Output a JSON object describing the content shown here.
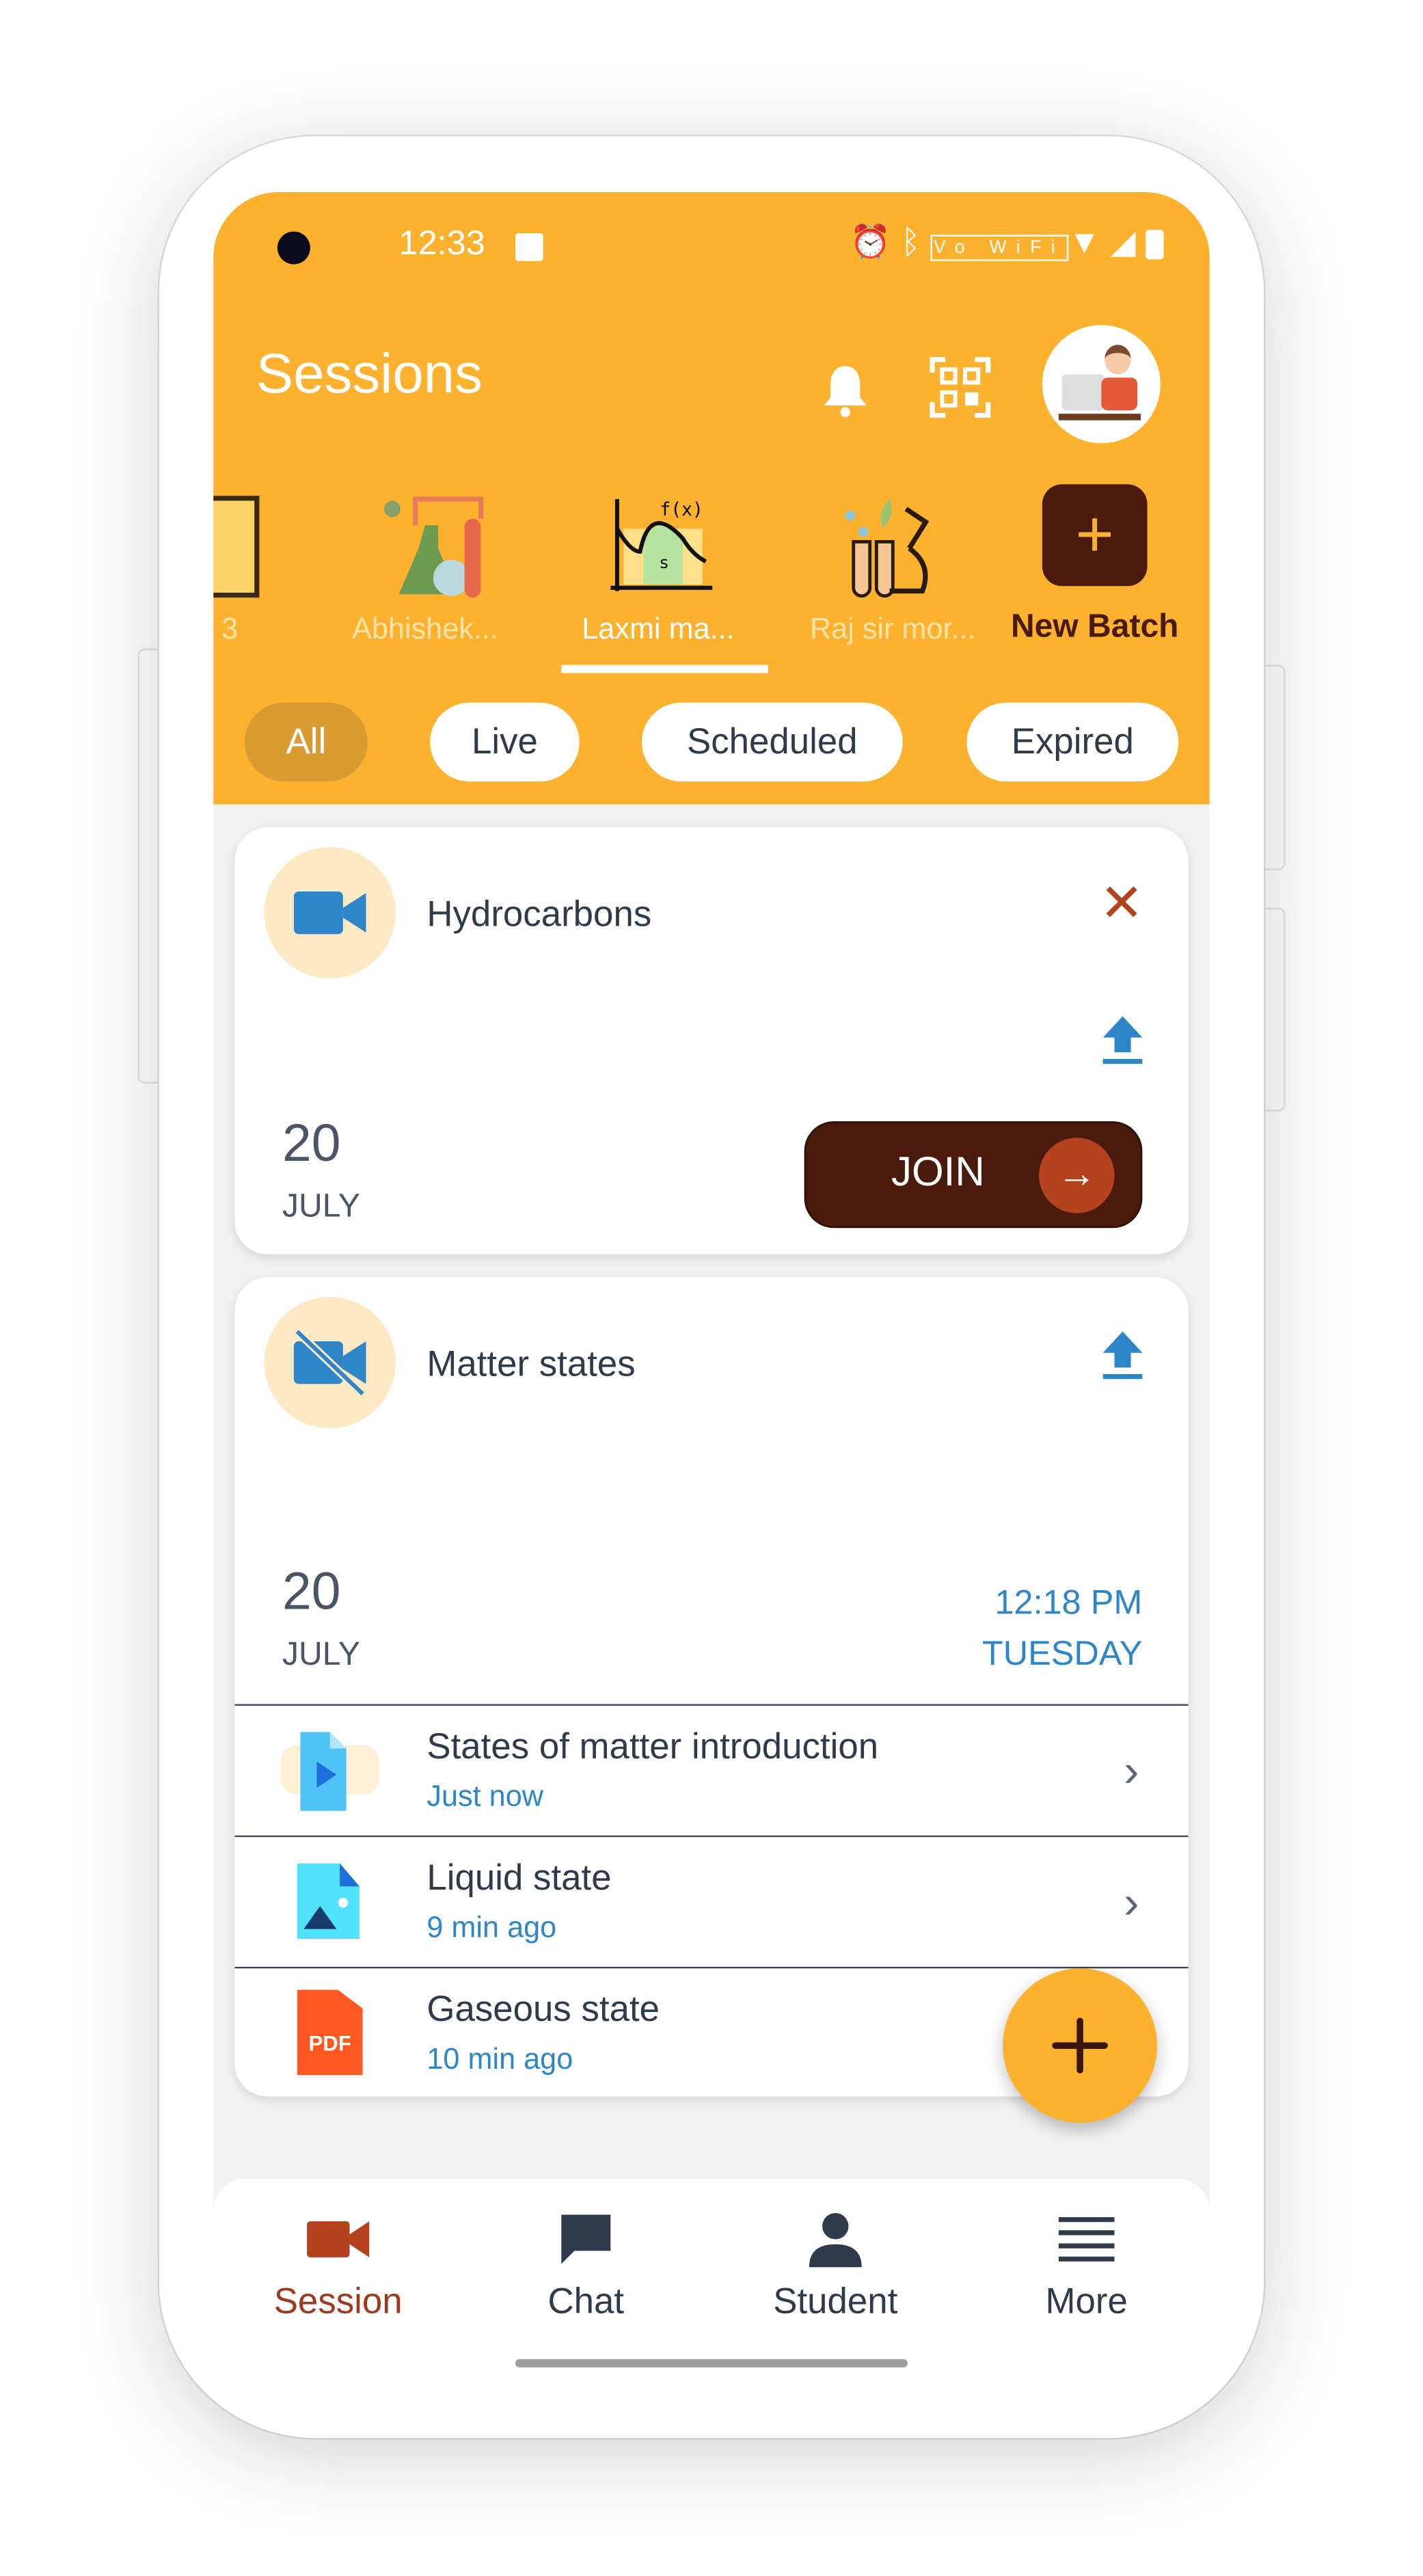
{
  "status_bar": {
    "time": "12:33"
  },
  "header": {
    "title": "Sessions"
  },
  "batches": [
    {
      "label": "3",
      "active": false
    },
    {
      "label": "Abhishek...",
      "active": false
    },
    {
      "label": "Laxmi ma...",
      "active": true
    },
    {
      "label": "Raj sir mor...",
      "active": false
    }
  ],
  "new_batch_label": "New Batch",
  "filters": [
    {
      "label": "All",
      "active": true
    },
    {
      "label": "Live"
    },
    {
      "label": "Scheduled"
    },
    {
      "label": "Expired"
    }
  ],
  "sessions": [
    {
      "title": "Hydrocarbons",
      "day": "20",
      "month": "JULY",
      "join_label": "JOIN",
      "icon": "video-camera-icon"
    },
    {
      "title": "Matter states",
      "day": "20",
      "month": "JULY",
      "time": "12:18 PM",
      "weekday": "TUESDAY",
      "icon": "video-off-icon",
      "files": [
        {
          "title": "States of matter introduction",
          "sub": "Just now",
          "icon": "video-file-icon"
        },
        {
          "title": "Liquid state",
          "sub": "9 min ago",
          "icon": "image-file-icon"
        },
        {
          "title": "Gaseous state",
          "sub": "10 min ago",
          "icon": "pdf-file-icon",
          "badge": "PDF"
        }
      ]
    }
  ],
  "bottom_nav": [
    {
      "label": "Session",
      "active": true
    },
    {
      "label": "Chat"
    },
    {
      "label": "Student"
    },
    {
      "label": "More"
    }
  ],
  "colors": {
    "primary": "#FDB22F",
    "dark": "#4A1A0C",
    "accent": "#B5421F",
    "link": "#2E86C8",
    "active_nav": "#9B3A1E"
  }
}
